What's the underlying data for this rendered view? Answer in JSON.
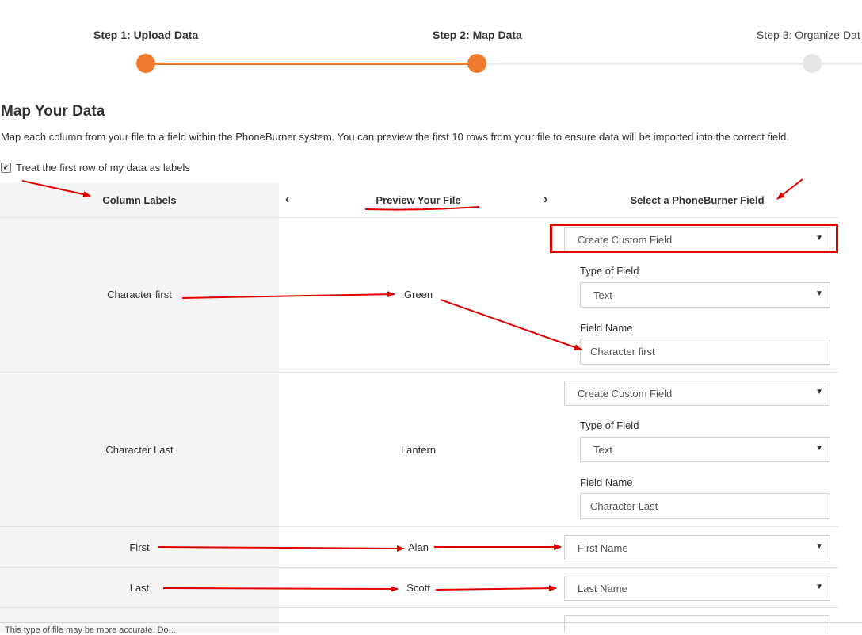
{
  "steps": [
    {
      "label": "Step 1: Upload Data",
      "state": "complete"
    },
    {
      "label": "Step 2: Map Data",
      "state": "current"
    },
    {
      "label": "Step 3: Organize Dat",
      "state": "upcoming"
    }
  ],
  "page": {
    "title": "Map Your Data",
    "description": "Map each column from your file to a field within the PhoneBurner system. You can preview the first 10 rows from your file to ensure data will be imported into the correct field.",
    "first_row_labels": {
      "label": "Treat the first row of my data as labels",
      "checked": true
    }
  },
  "table": {
    "headers": {
      "labels": "Column Labels",
      "preview": "Preview Your File",
      "field": "Select a PhoneBurner Field"
    },
    "type_label": "Type of Field",
    "name_label": "Field Name",
    "rows": [
      {
        "label": "Character first",
        "preview": "Green",
        "field": "Create Custom Field",
        "type": "Text",
        "name": "Character first"
      },
      {
        "label": "Character Last",
        "preview": "Lantern",
        "field": "Create Custom Field",
        "type": "Text",
        "name": "Character Last"
      },
      {
        "label": "First",
        "preview": "Alan",
        "field": "First Name"
      },
      {
        "label": "Last",
        "preview": "Scott",
        "field": "Last Name"
      }
    ]
  },
  "footer": {
    "text": "This type of file may be more accurate. Do..."
  },
  "colors": {
    "accent": "#ef7b2f",
    "annotation": "#e00000"
  }
}
